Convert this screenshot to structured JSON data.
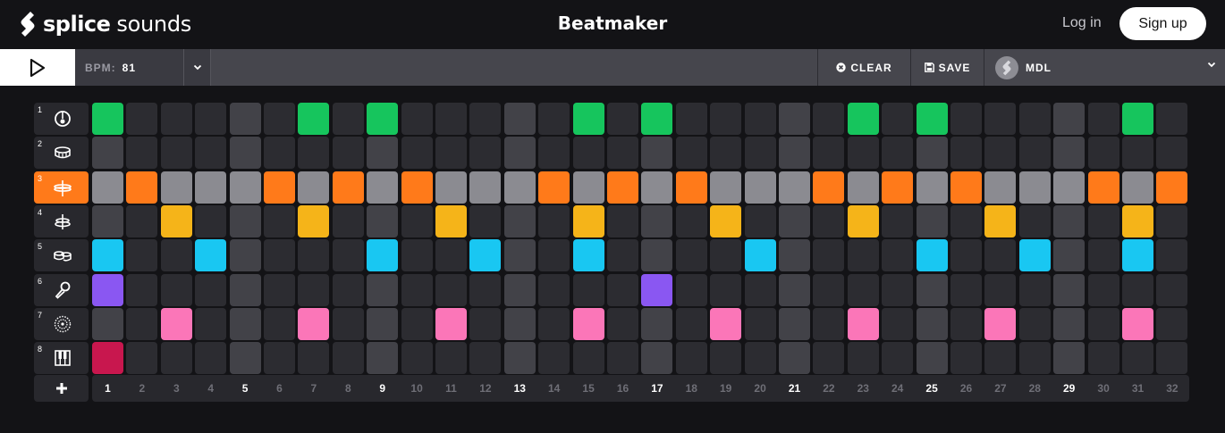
{
  "header": {
    "brand": "splice",
    "product": "sounds",
    "title": "Beatmaker",
    "login_label": "Log in",
    "signup_label": "Sign up"
  },
  "toolbar": {
    "play_icon": "play-icon",
    "bpm_label": "BPM:",
    "bpm_value": "81",
    "clear_label": "CLEAR",
    "save_label": "SAVE",
    "kit_name": "MDL"
  },
  "colors": {
    "empty": "#2c2c31",
    "beat_empty": "#424248",
    "hihat_empty": "#8b8b91",
    "kick": "#16c55d",
    "hihat": "#ff7a1a",
    "tom": "#f5b419",
    "snare_alt": "#19c7f2",
    "mic": "#8a57f2",
    "fx": "#fb76b8",
    "keys": "#c8174e"
  },
  "tracks": [
    {
      "number": "1",
      "icon": "kick-drum-icon",
      "color_key": "kick",
      "active": false,
      "steps": [
        1,
        7,
        9,
        15,
        17,
        23,
        25,
        31
      ]
    },
    {
      "number": "2",
      "icon": "snare-drum-icon",
      "color_key": "kick",
      "active": false,
      "steps": []
    },
    {
      "number": "3",
      "icon": "hihat-icon",
      "color_key": "hihat",
      "active": true,
      "steps": [
        2,
        6,
        8,
        10,
        14,
        16,
        18,
        22,
        24,
        26,
        30,
        32
      ]
    },
    {
      "number": "4",
      "icon": "cymbal-icon",
      "color_key": "tom",
      "active": false,
      "steps": [
        3,
        7,
        11,
        15,
        19,
        23,
        27,
        31
      ]
    },
    {
      "number": "5",
      "icon": "bongo-icon",
      "color_key": "snare_alt",
      "active": false,
      "steps": [
        1,
        4,
        9,
        12,
        15,
        20,
        25,
        28,
        31
      ]
    },
    {
      "number": "6",
      "icon": "microphone-icon",
      "color_key": "mic",
      "active": false,
      "steps": [
        1,
        17
      ]
    },
    {
      "number": "7",
      "icon": "fx-circle-icon",
      "color_key": "fx",
      "active": false,
      "steps": [
        3,
        7,
        11,
        15,
        19,
        23,
        27,
        31
      ]
    },
    {
      "number": "8",
      "icon": "piano-keys-icon",
      "color_key": "keys",
      "active": false,
      "steps": [
        1
      ]
    }
  ],
  "step_numbers": [
    "1",
    "2",
    "3",
    "4",
    "5",
    "6",
    "7",
    "8",
    "9",
    "10",
    "11",
    "12",
    "13",
    "14",
    "15",
    "16",
    "17",
    "18",
    "19",
    "20",
    "21",
    "22",
    "23",
    "24",
    "25",
    "26",
    "27",
    "28",
    "29",
    "30",
    "31",
    "32"
  ]
}
